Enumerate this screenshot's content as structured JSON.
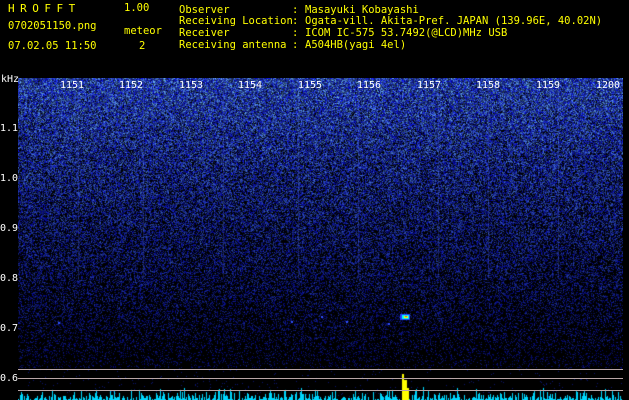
{
  "header": {
    "brand": "HROFFT",
    "version": "1.00",
    "filename": "0702051150.png",
    "meteor_label": "meteor",
    "date": "07.02.05 11:50",
    "meteor_count": "2"
  },
  "metadata": [
    {
      "key": "Observer",
      "value": "Masayuki Kobayashi"
    },
    {
      "key": "Receiving Location",
      "value": "Ogata-vill. Akita-Pref. JAPAN (139.96E, 40.02N)"
    },
    {
      "key": "Receiver",
      "value": "ICOM IC-575 53.7492(@LCD)MHz USB"
    },
    {
      "key": "Receiving antenna",
      "value": "A504HB(yagi 4el)"
    }
  ],
  "separator": ":",
  "spectrogram": {
    "y_unit": "kHz",
    "y_ticks": [
      "1.1",
      "1.0",
      "0.9",
      "0.8",
      "0.7",
      "0.6"
    ],
    "x_ticks": [
      "1151",
      "1152",
      "1153",
      "1154",
      "1155",
      "1156",
      "1157",
      "1158",
      "1159",
      "1200"
    ],
    "colors": {
      "noise_high": "#3a5cff",
      "noise_low": "#1a1a6a",
      "background": "#000000",
      "signal": "#ffff00"
    }
  }
}
